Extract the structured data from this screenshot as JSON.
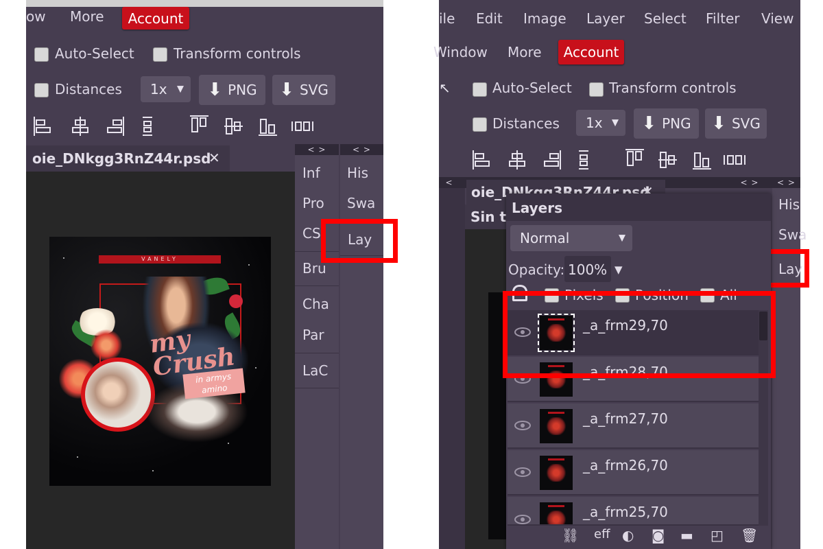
{
  "left": {
    "menu": {
      "item_partial": "ow",
      "more": "More",
      "account": "Account"
    },
    "options": {
      "auto_select": "Auto-Select",
      "transform_controls": "Transform controls",
      "distances": "Distances",
      "scale": "1x",
      "png": "PNG",
      "svg": "SVG"
    },
    "doc_tab": {
      "title": "oie_DNkgg3RnZ44r.psd",
      "close": "✕"
    },
    "collapsers": [
      "< >",
      "< >"
    ],
    "panel_col1": [
      "Inf",
      "Pro",
      "CS",
      "Bru",
      "Cha",
      "Par",
      "LaC"
    ],
    "panel_col2": [
      "His",
      "Swa",
      "Lay"
    ],
    "artwork": {
      "banner": "VANELY",
      "script_title": "my Crush",
      "sub1": "in armys",
      "sub2": "amino"
    }
  },
  "right": {
    "menu": [
      "ile",
      "Edit",
      "Image",
      "Layer",
      "Select",
      "Filter",
      "View"
    ],
    "menu2": {
      "window": "Window",
      "more": "More",
      "account": "Account"
    },
    "options": {
      "auto_select": "Auto-Select",
      "transform_controls": "Transform controls",
      "distances": "Distances",
      "scale": "1x",
      "png": "PNG",
      "svg": "SVG"
    },
    "collapsers": [
      "< ",
      "< >",
      "< >"
    ],
    "doc_tab": {
      "title": "oie_DNkgg3RnZ44r.psd",
      "close": "✕"
    },
    "doc_tab2": "Sin tí",
    "side_col": [
      "His",
      "Swa",
      "Lay"
    ],
    "layers_panel": {
      "title": "Layers",
      "blend_mode": "Normal",
      "opacity_label": "Opacity:",
      "opacity_value": "100%",
      "lock_labels": [
        "Pixels",
        "Position",
        "All"
      ],
      "layers": [
        "_a_frm29,70",
        "_a_frm28,70",
        "_a_frm27,70",
        "_a_frm26,70",
        "_a_frm25,70"
      ],
      "bottom_icons": [
        "link-icon",
        "eff",
        "adjustment-icon",
        "mask-icon",
        "folder-icon",
        "new-layer-icon",
        "trash-icon"
      ],
      "eff_label": "eff"
    }
  },
  "colors": {
    "panel": "#463d50",
    "sidebar": "#4e4558",
    "canvas": "#272727",
    "account": "#c8101b",
    "highlight": "#ff0000"
  }
}
